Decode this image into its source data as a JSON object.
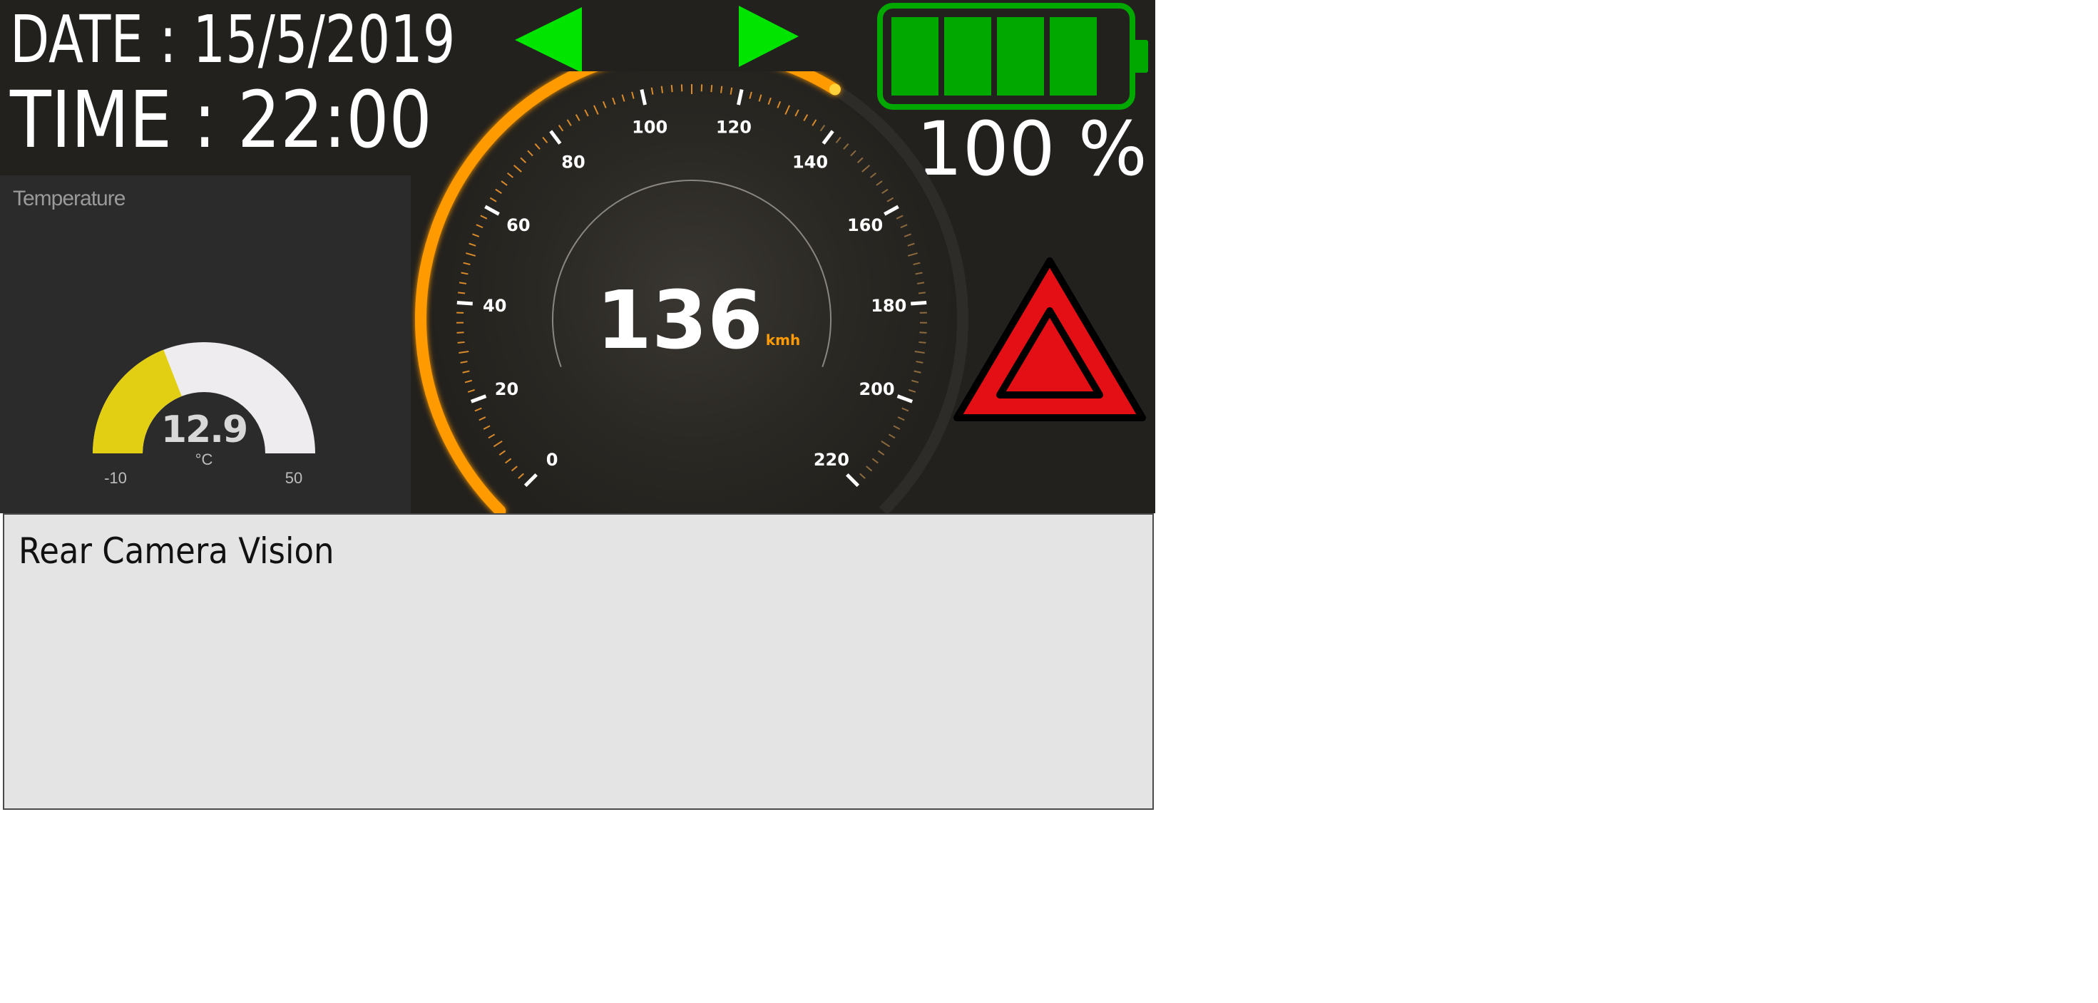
{
  "header": {
    "date_text": "DATE : 15/5/2019",
    "time_text": "TIME : 22:00"
  },
  "turn_signals": {
    "left_icon": "left-turn-arrow-icon",
    "right_icon": "right-turn-arrow-icon",
    "color": "#00e400"
  },
  "battery": {
    "icon": "battery-icon",
    "level_percent": 100,
    "bars_filled": 4,
    "bars_total": 4,
    "percent_text": "100 %",
    "color": "#00a800"
  },
  "temperature": {
    "title": "Temperature",
    "value": "12.9",
    "unit": "°C",
    "min": "-10",
    "max": "50",
    "value_num": 12.9,
    "min_num": -10,
    "max_num": 50,
    "fill_color": "#e2cf14",
    "track_color": "#eeecef"
  },
  "speedometer": {
    "value": "136",
    "unit": "kmh",
    "value_num": 136,
    "min_num": 0,
    "max_num": 220,
    "tick_labels": [
      "0",
      "20",
      "40",
      "60",
      "80",
      "100",
      "120",
      "140",
      "160",
      "180",
      "200",
      "220"
    ],
    "accent_color": "#ff9a00"
  },
  "hazard": {
    "icon": "hazard-warning-icon",
    "color": "#e40f14"
  },
  "camera": {
    "title": "Rear Camera Vision"
  }
}
